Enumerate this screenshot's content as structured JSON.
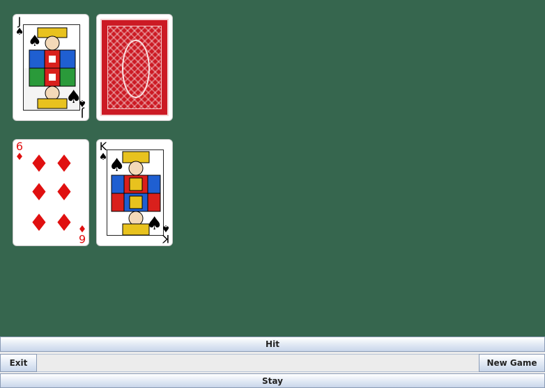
{
  "colors": {
    "table_felt": "#36664e",
    "card_red": "#e01010",
    "card_back": "#cc1a24"
  },
  "dealer": {
    "cards": [
      {
        "rank": "J",
        "suit": "♠",
        "face_up": true
      },
      {
        "face_up": false
      }
    ]
  },
  "player": {
    "cards": [
      {
        "rank": "6",
        "suit": "♦",
        "face_up": true
      },
      {
        "rank": "K",
        "suit": "♠",
        "face_up": true
      }
    ]
  },
  "controls": {
    "hit_label": "Hit",
    "exit_label": "Exit",
    "new_game_label": "New Game",
    "stay_label": "Stay",
    "status_text": ""
  }
}
